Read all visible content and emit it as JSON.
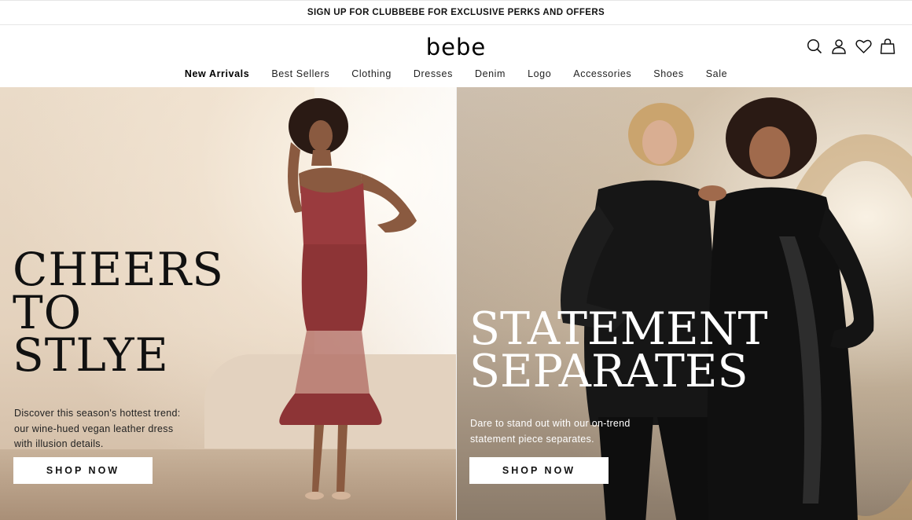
{
  "promo": {
    "text": "SIGN UP FOR CLUBBEBE FOR EXCLUSIVE PERKS AND OFFERS"
  },
  "header": {
    "logo": "bebe",
    "icons": [
      "search-icon",
      "account-icon",
      "wishlist-heart-icon",
      "shopping-bag-icon"
    ]
  },
  "nav": {
    "items": [
      {
        "label": "New Arrivals"
      },
      {
        "label": "Best Sellers"
      },
      {
        "label": "Clothing"
      },
      {
        "label": "Dresses"
      },
      {
        "label": "Denim"
      },
      {
        "label": "Logo"
      },
      {
        "label": "Accessories"
      },
      {
        "label": "Shoes"
      },
      {
        "label": "Sale"
      }
    ]
  },
  "hero_left": {
    "headline": "CHEERS\nTO\nSTLYE",
    "description": "Discover this season's hottest trend:\nour wine-hued vegan leather dress\nwith illusion details.",
    "button": "SHOP NOW"
  },
  "hero_right": {
    "headline": "STATEMENT\nSEPARATES",
    "description": "Dare to stand out with our on-trend\nstatement piece separates.",
    "button": "SHOP NOW"
  },
  "colors": {
    "dress": "#9a3b3e",
    "leather": "#141414",
    "text_dark": "#111111",
    "text_light": "#ffffff"
  }
}
